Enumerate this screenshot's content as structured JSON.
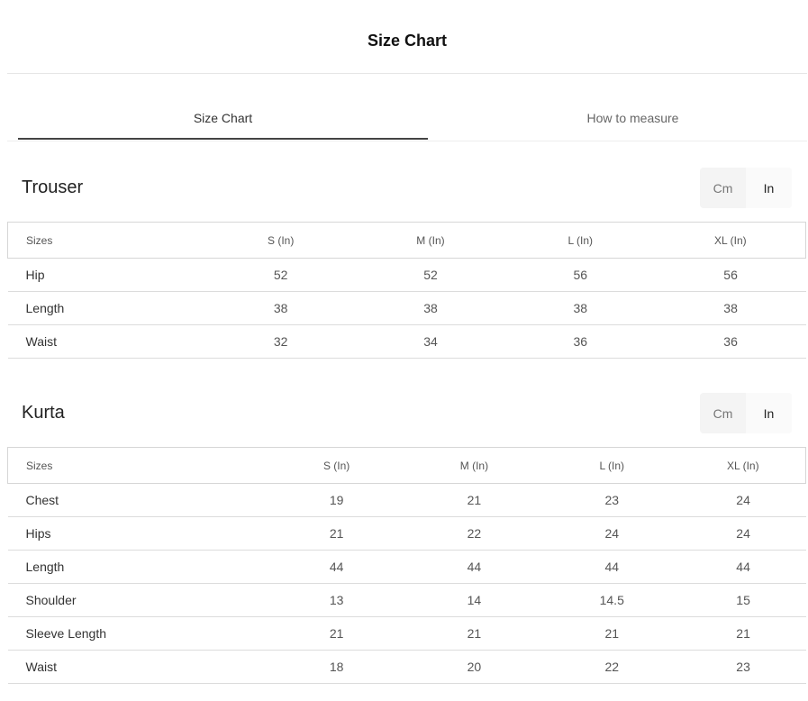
{
  "header": {
    "title": "Size Chart"
  },
  "tabs": [
    {
      "label": "Size Chart",
      "active": true
    },
    {
      "label": "How to measure",
      "active": false
    }
  ],
  "units": {
    "cm_label": "Cm",
    "in_label": "In",
    "selected": "In"
  },
  "trouser": {
    "title": "Trouser",
    "columns": [
      "Sizes",
      "S (In)",
      "M (In)",
      "L (In)",
      "XL (In)"
    ],
    "rows": [
      [
        "Hip",
        "52",
        "52",
        "56",
        "56"
      ],
      [
        "Length",
        "38",
        "38",
        "38",
        "38"
      ],
      [
        "Waist",
        "32",
        "34",
        "36",
        "36"
      ]
    ]
  },
  "kurta": {
    "title": "Kurta",
    "columns": [
      "Sizes",
      "S (In)",
      "M (In)",
      "L (In)",
      "XL (In)"
    ],
    "rows": [
      [
        "Chest",
        "19",
        "21",
        "23",
        "24"
      ],
      [
        "Hips",
        "21",
        "22",
        "24",
        "24"
      ],
      [
        "Length",
        "44",
        "44",
        "44",
        "44"
      ],
      [
        "Shoulder",
        "13",
        "14",
        "14.5",
        "15"
      ],
      [
        "Sleeve Length",
        "21",
        "21",
        "21",
        "21"
      ],
      [
        "Waist",
        "18",
        "20",
        "22",
        "23"
      ]
    ]
  }
}
